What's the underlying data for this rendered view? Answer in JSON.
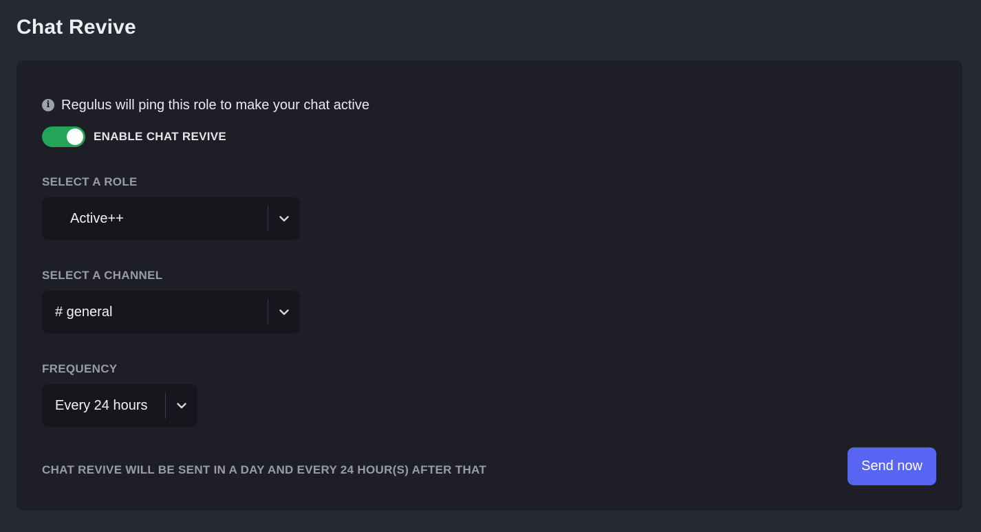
{
  "page": {
    "title": "Chat Revive"
  },
  "info": {
    "icon": "info-circle-icon",
    "text": "Regulus will ping this role to make your chat active"
  },
  "toggle": {
    "label": "ENABLE CHAT REVIVE",
    "enabled": true,
    "color": "#23a559"
  },
  "role": {
    "label": "SELECT A ROLE",
    "value": "Active++"
  },
  "channel": {
    "label": "SELECT A CHANNEL",
    "value": "# general"
  },
  "frequency": {
    "label": "FREQUENCY",
    "value": "Every 24 hours"
  },
  "footer": {
    "text": "CHAT REVIVE WILL BE SENT IN A DAY AND EVERY 24 HOUR(S) AFTER THAT"
  },
  "send_button": {
    "label": "Send now",
    "color": "#5865f2"
  },
  "colors": {
    "background": "#262833",
    "panel": "#1e1f26",
    "select_bg": "#16171d"
  }
}
